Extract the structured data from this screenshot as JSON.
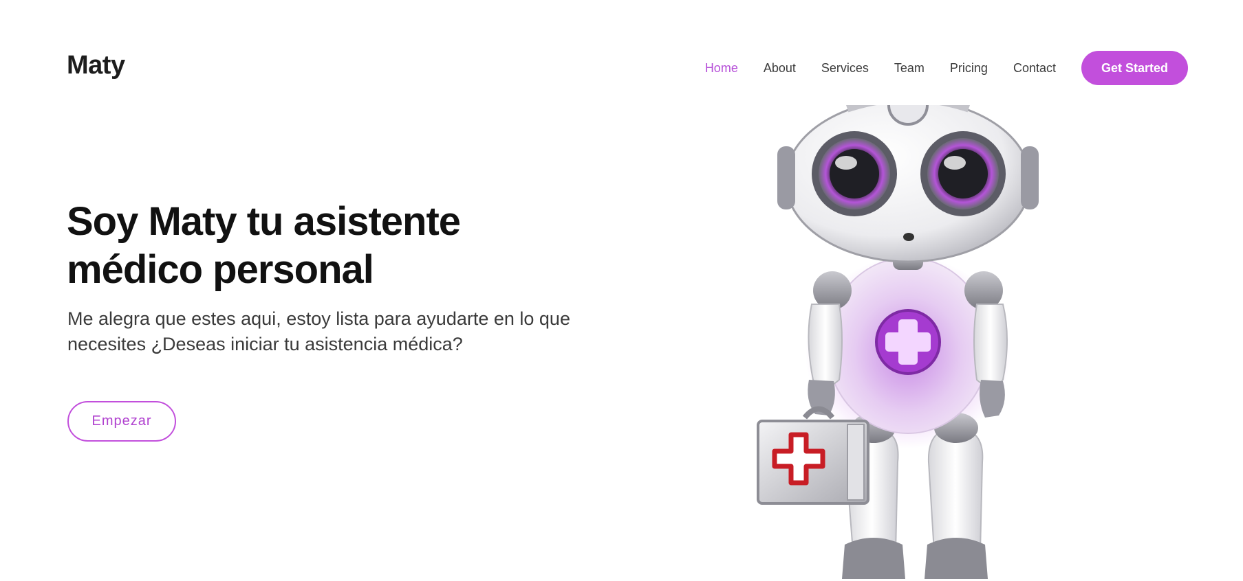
{
  "brand": {
    "name": "Maty"
  },
  "nav": {
    "items": [
      {
        "label": "Home",
        "active": true
      },
      {
        "label": "About",
        "active": false
      },
      {
        "label": "Services",
        "active": false
      },
      {
        "label": "Team",
        "active": false
      },
      {
        "label": "Pricing",
        "active": false
      },
      {
        "label": "Contact",
        "active": false
      }
    ],
    "cta_label": "Get Started"
  },
  "hero": {
    "title": "Soy Maty tu asistente médico personal",
    "subtitle": "Me alegra que estes aqui, estoy lista para ayudarte en lo que necesites ¿Deseas iniciar tu asistencia médica?",
    "button_label": "Empezar"
  },
  "colors": {
    "accent": "#c24fdc",
    "accent_text": "#b041cf",
    "heading": "#111111",
    "body": "#3a3a3a"
  },
  "images": {
    "hero_illustration": "robot-doctor-with-medical-case"
  }
}
